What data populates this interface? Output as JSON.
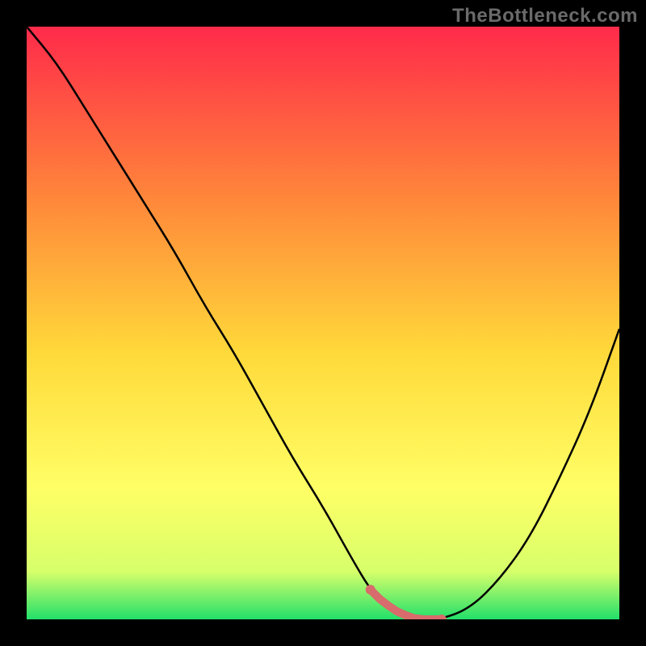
{
  "watermark": "TheBottleneck.com",
  "colors": {
    "frame_bg": "#000000",
    "gradient_top": "#ff2a4a",
    "gradient_mid1": "#ff8a3a",
    "gradient_mid2": "#ffd93a",
    "gradient_mid3": "#ffff66",
    "gradient_mid4": "#d6ff6a",
    "gradient_bottom": "#22e06a",
    "curve": "#000000",
    "marker_stroke": "#d86b6b",
    "marker_fill": "#d86b6b"
  },
  "chart_data": {
    "type": "line",
    "title": "",
    "xlabel": "",
    "ylabel": "",
    "xlim": [
      0,
      100
    ],
    "ylim": [
      0,
      100
    ],
    "x": [
      0,
      5,
      10,
      15,
      20,
      25,
      30,
      35,
      40,
      45,
      50,
      55,
      58,
      60,
      63,
      66,
      70,
      75,
      80,
      85,
      90,
      95,
      100
    ],
    "values": [
      100,
      94,
      86,
      78,
      70,
      62,
      53,
      45,
      36,
      27,
      19,
      10,
      5,
      3,
      1,
      0,
      0,
      2,
      7,
      14,
      24,
      35,
      49
    ],
    "min_range_x": [
      58,
      70
    ],
    "notes": "Bottleneck curve. Minimum (optimal pairing, ~0% bottleneck) occurs around x=63–70. Highlighted band shown in coral near minimum."
  }
}
